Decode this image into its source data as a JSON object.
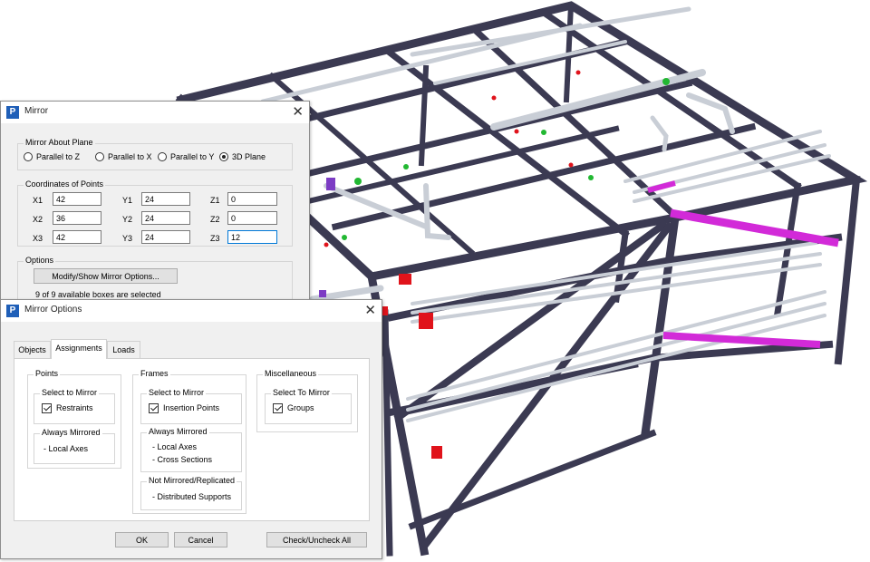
{
  "mirror": {
    "title": "Mirror",
    "plane": {
      "group_label": "Mirror About Plane",
      "options": [
        "Parallel to Z",
        "Parallel to X",
        "Parallel to Y",
        "3D Plane"
      ],
      "selected": "3D Plane"
    },
    "coords": {
      "group_label": "Coordinates of Points",
      "x1_label": "X1",
      "x1": "42",
      "y1_label": "Y1",
      "y1": "24",
      "z1_label": "Z1",
      "z1": "0",
      "x2_label": "X2",
      "x2": "36",
      "y2_label": "Y2",
      "y2": "24",
      "z2_label": "Z2",
      "z2": "0",
      "x3_label": "X3",
      "x3": "42",
      "y3_label": "Y3",
      "y3": "24",
      "z3_label": "Z3",
      "z3": "12"
    },
    "options": {
      "group_label": "Options",
      "button": "Modify/Show Mirror Options...",
      "status": "9 of 9 available boxes are selected"
    }
  },
  "mirror_options": {
    "title": "Mirror Options",
    "tabs": [
      "Objects",
      "Assignments",
      "Loads"
    ],
    "active_tab": "Assignments",
    "points": {
      "label": "Points",
      "select_label": "Select to Mirror",
      "restraints": "Restraints",
      "restraints_checked": true,
      "always_label": "Always Mirrored",
      "always_item": "- Local Axes"
    },
    "frames": {
      "label": "Frames",
      "select_label": "Select to Mirror",
      "insertion": "Insertion Points",
      "insertion_checked": true,
      "always_label": "Always Mirrored",
      "always_item1": "- Local Axes",
      "always_item2": "- Cross Sections",
      "not_label": "Not Mirrored/Replicated",
      "not_item": "- Distributed Supports"
    },
    "misc": {
      "label": "Miscellaneous",
      "select_label": "Select To Mirror",
      "groups": "Groups",
      "groups_checked": true
    },
    "ok": "OK",
    "cancel": "Cancel",
    "check_all": "Check/Uncheck All"
  },
  "colors": {
    "steel": "#3b3a52",
    "pipe": "#c9ced6",
    "accent_magenta": "#d22ad8",
    "marker_red": "#e0131b",
    "marker_green": "#22b832",
    "title_icon": "#1f5fb8"
  }
}
